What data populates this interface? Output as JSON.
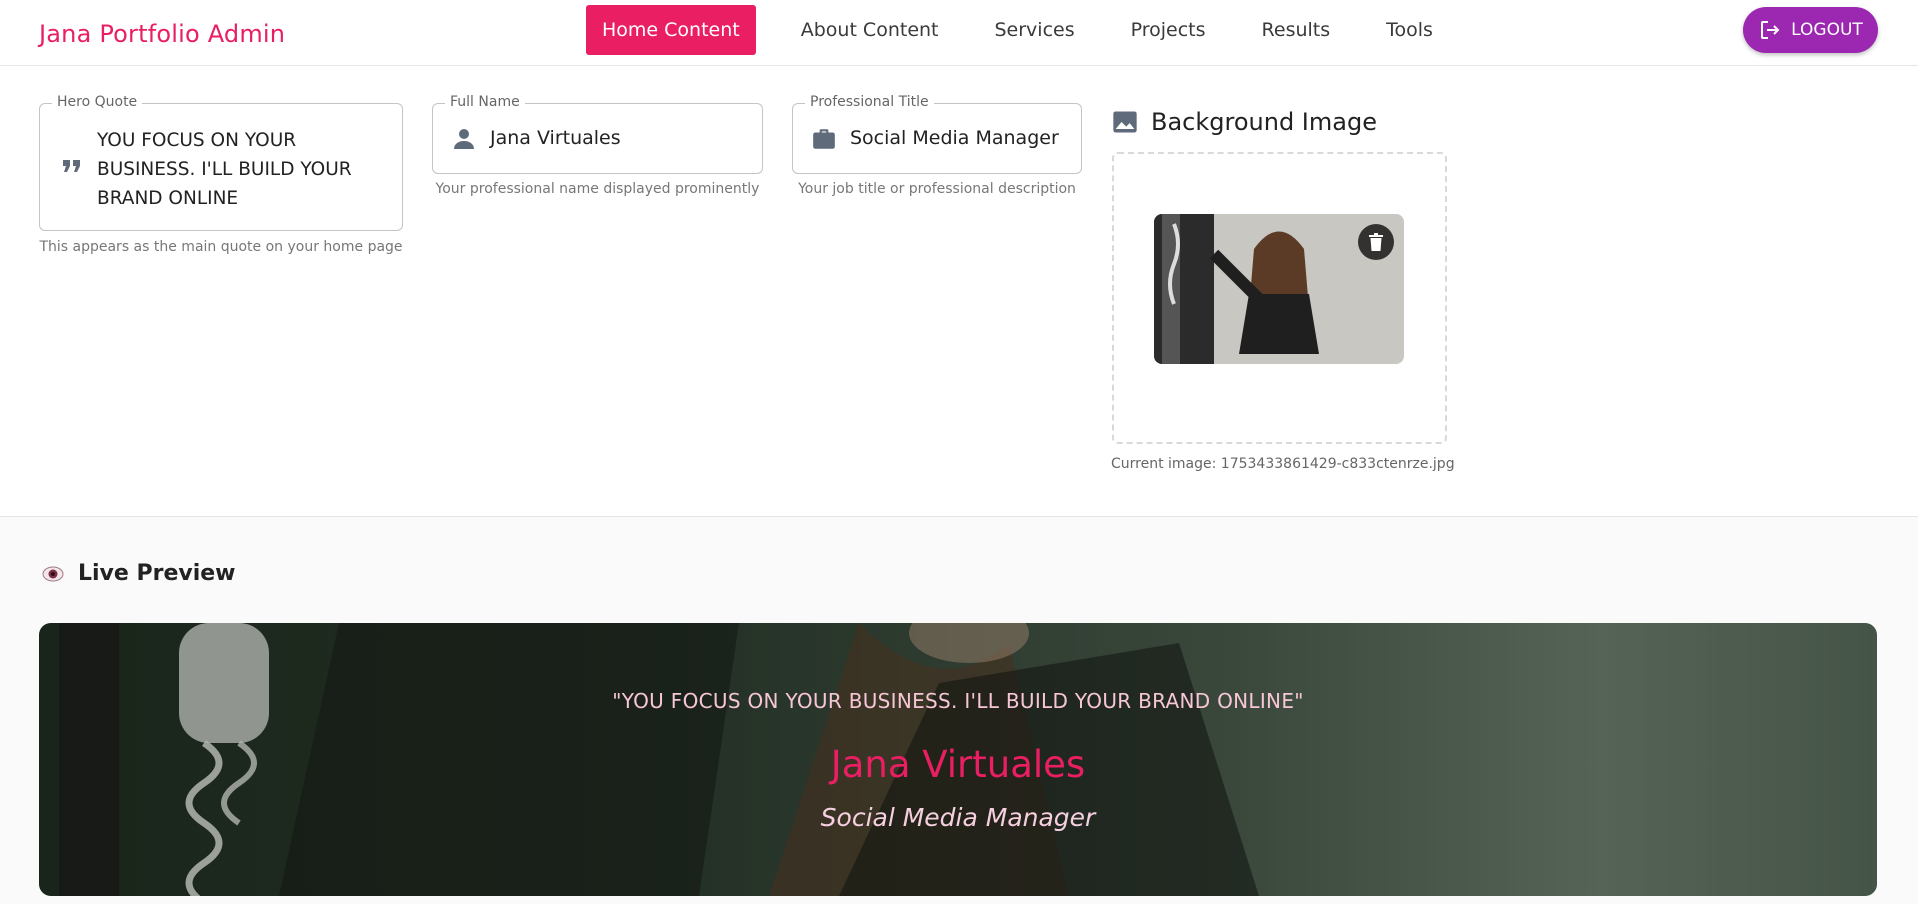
{
  "header": {
    "brand": "Jana Portfolio Admin",
    "nav": [
      "Home Content",
      "About Content",
      "Services",
      "Projects",
      "Results",
      "Tools"
    ],
    "active_index": 0,
    "logout_label": "LOGOUT"
  },
  "form": {
    "hero_quote": {
      "label": "Hero Quote",
      "value_lines": [
        "YOU FOCUS ON YOUR",
        "BUSINESS. I'LL BUILD YOUR",
        "BRAND ONLINE"
      ],
      "helper": "This appears as the main quote on your home page",
      "icon": "quote-icon"
    },
    "full_name": {
      "label": "Full Name",
      "value": "Jana Virtuales",
      "helper": "Your professional name displayed prominently",
      "icon": "person-icon"
    },
    "professional_title": {
      "label": "Professional Title",
      "value": "Social Media Manager",
      "helper": "Your job title or professional description",
      "icon": "briefcase-icon"
    },
    "background_image": {
      "title": "Background Image",
      "current_label": "Current image: 1753433861429-c833ctenrze.jpg",
      "icon": "image-icon"
    }
  },
  "preview": {
    "title": "Live Preview",
    "quote": "\"YOU FOCUS ON YOUR BUSINESS. I'LL BUILD YOUR BRAND ONLINE\"",
    "name": "Jana Virtuales",
    "subtitle": "Social Media Manager"
  },
  "colors": {
    "accent": "#e91e63",
    "logout": "#9c27b0"
  }
}
